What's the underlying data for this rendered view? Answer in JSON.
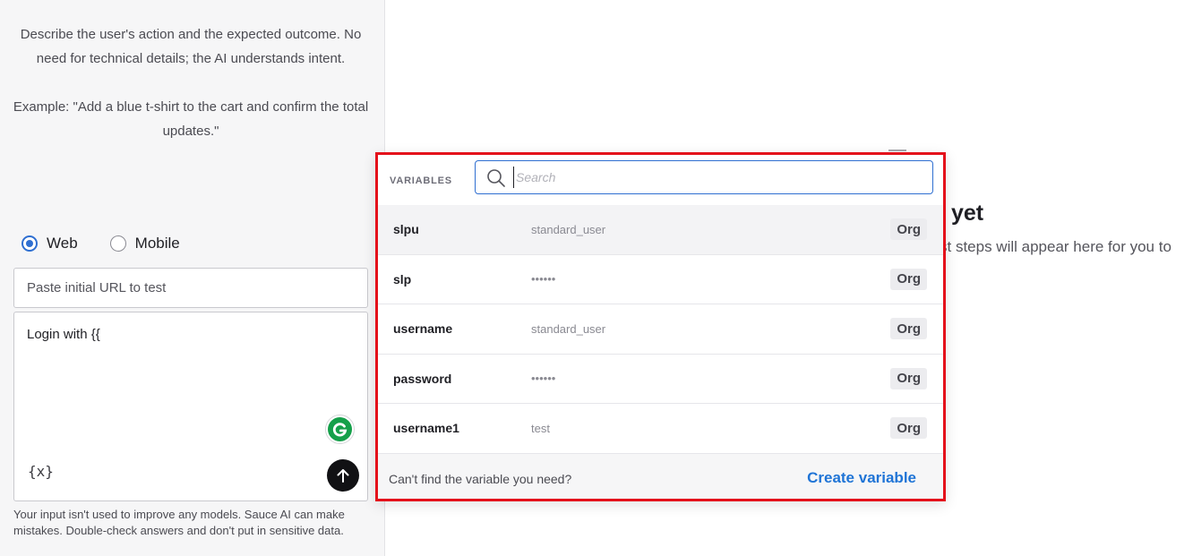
{
  "intro": {
    "line1": "Describe the user's action and the expected outcome. No need for technical details; the AI understands intent.",
    "line2": "Example: \"Add a blue t-shirt to the cart and confirm the total updates.\""
  },
  "platform": {
    "options": [
      {
        "label": "Web",
        "selected": true
      },
      {
        "label": "Mobile",
        "selected": false
      }
    ]
  },
  "url_input": {
    "placeholder": "Paste initial URL to test",
    "value": ""
  },
  "prompt": {
    "text": "Login with {{",
    "variable_button": "{x}",
    "send_icon": "arrow-up-icon",
    "grammarly_icon": "grammarly-icon"
  },
  "disclaimer": "Your input isn't used to improve any models. Sauce AI can make mistakes. Double-check answers and don't put in sensitive data.",
  "background": {
    "heading_fragment": "yet",
    "desc_fragment": "st steps will appear here for you to"
  },
  "variables_popup": {
    "title": "VARIABLES",
    "search_placeholder": "Search",
    "search_value": "",
    "items": [
      {
        "name": "slpu",
        "value": "standard_user",
        "scope": "Org"
      },
      {
        "name": "slp",
        "value": "••••••",
        "scope": "Org"
      },
      {
        "name": "username",
        "value": "standard_user",
        "scope": "Org"
      },
      {
        "name": "password",
        "value": "••••••",
        "scope": "Org"
      },
      {
        "name": "username1",
        "value": "test",
        "scope": "Org"
      }
    ],
    "footer_hint": "Can't find the variable you need?",
    "create_label": "Create variable"
  },
  "colors": {
    "accent": "#2f6fd1",
    "link": "#1f74d6",
    "highlight_border": "#e4111b",
    "send_button": "#111114"
  }
}
